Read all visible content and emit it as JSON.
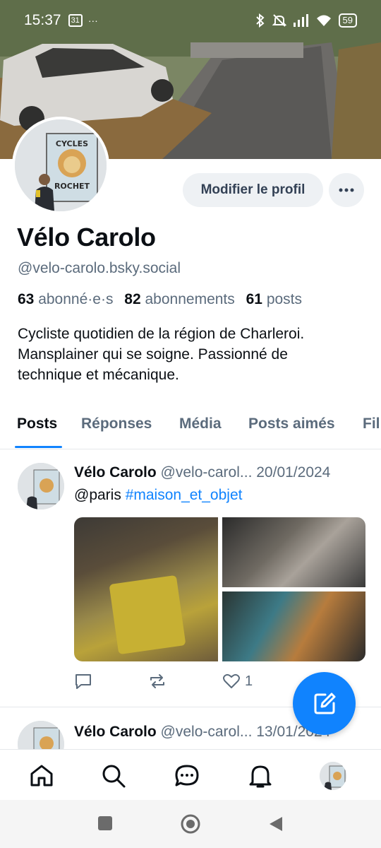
{
  "status_bar": {
    "time": "15:37",
    "notification_badge": "31",
    "more_dots": "···",
    "battery": "59"
  },
  "profile": {
    "display_name": "Vélo Carolo",
    "handle": "@velo-carolo.bsky.social",
    "followers_count": "63",
    "followers_label": "abonné·e·s",
    "following_count": "82",
    "following_label": "abonnements",
    "posts_count": "61",
    "posts_label": "posts",
    "bio_lines": [
      "Cycliste quotidien de la région de Charleroi.",
      "Mansplainer qui se soigne. Passionné de",
      "technique et mécanique."
    ],
    "edit_button": "Modifier le profil",
    "avatar_sign_top": "CYCLES",
    "avatar_sign_bottom": "ROCHET"
  },
  "tabs": [
    {
      "label": "Posts",
      "active": true
    },
    {
      "label": "Réponses",
      "active": false
    },
    {
      "label": "Média",
      "active": false
    },
    {
      "label": "Posts aimés",
      "active": false
    },
    {
      "label": "Fil",
      "active": false
    }
  ],
  "posts": [
    {
      "author": "Vélo Carolo",
      "handle": "@velo-carol...",
      "date": "20/01/2024",
      "text_mention": "@paris",
      "text_hashtag": "#maison_et_objet",
      "likes": "1"
    },
    {
      "author": "Vélo Carolo",
      "handle": "@velo-carol...",
      "date": "13/01/2024"
    }
  ],
  "colors": {
    "accent": "#1083fe",
    "text_primary": "#0b0f14",
    "text_secondary": "#5b6b7c",
    "button_bg": "#eef1f4"
  }
}
